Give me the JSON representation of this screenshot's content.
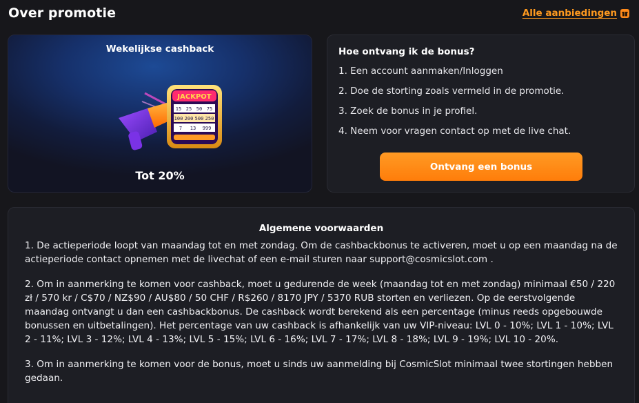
{
  "header": {
    "title": "Over promotie",
    "all_offers_label": "Alle aanbiedingen",
    "all_offers_icon": "gift-icon"
  },
  "promo": {
    "title": "Wekelijkse cashback",
    "jackpot_text": "JACKPOT",
    "slot_rows": [
      [
        "15",
        "25",
        "50",
        "75"
      ],
      [
        "100",
        "200",
        "500",
        "250"
      ],
      [
        "7",
        "13",
        "999",
        "777"
      ]
    ],
    "value": "Tot 20%"
  },
  "steps": {
    "title": "Hoe ontvang ik de bonus?",
    "items": [
      "1. Een account aanmaken/Inloggen",
      "2. Doe de storting zoals vermeld in de promotie.",
      "3. Zoek de bonus in je profiel.",
      "4. Neem voor vragen contact op met de live chat."
    ],
    "button_label": "Ontvang een bonus"
  },
  "terms": {
    "title": "Algemene voorwaarden",
    "paragraphs": [
      "1. De actieperiode loopt van maandag tot en met zondag. Om de cashbackbonus te activeren, moet u op een maandag na de actieperiode contact opnemen met de livechat of een e-mail sturen naar support@cosmicslot.com .",
      "2. Om in aanmerking te komen voor cashback, moet u gedurende de week (maandag tot en met zondag) minimaal €50 / 220 zł / 570 kr / C$70 / NZ$90 / AU$80 / 50 CHF / R$260 / 8170 JPY / 5370 RUB storten en verliezen. Op de eerstvolgende maandag ontvangt u dan een cashbackbonus. De cashback wordt berekend als een percentage (minus reeds opgebouwde bonussen en uitbetalingen). Het percentage van uw cashback is afhankelijk van uw VIP-niveau: LVL 0 - 10%; LVL 1 - 10%; LVL 2 - 11%; LVL 3 - 12%; LVL 4 - 13%; LVL 5 - 15%; LVL 6 - 16%; LVL 7 - 17%; LVL 8 - 18%; LVL 9 - 19%; LVL 10 - 20%.",
      "3. Om in aanmerking te komen voor de bonus, moet u sinds uw aanmelding bij CosmicSlot minimaal twee stortingen hebben gedaan."
    ]
  }
}
